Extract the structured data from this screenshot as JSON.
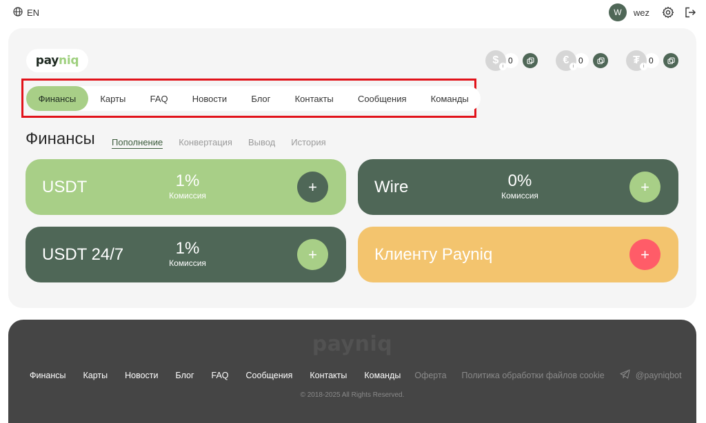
{
  "topbar": {
    "language": "EN",
    "user_initial": "W",
    "username": "wez"
  },
  "logo": {
    "left": "pay",
    "right": "niq"
  },
  "balances": [
    {
      "symbol": "$",
      "value": "0",
      "icon": "dollar-icon"
    },
    {
      "symbol": "€",
      "value": "0",
      "icon": "euro-icon"
    },
    {
      "symbol": "₮",
      "value": "0",
      "icon": "tether-icon"
    }
  ],
  "nav": {
    "items": [
      "Финансы",
      "Карты",
      "FAQ",
      "Новости",
      "Блог",
      "Контакты",
      "Сообщения",
      "Команды"
    ],
    "active": "Финансы"
  },
  "section": {
    "title": "Финансы",
    "subtabs": [
      "Пополнение",
      "Конвертация",
      "Вывод",
      "История"
    ],
    "active_subtab": "Пополнение"
  },
  "cards": [
    {
      "name": "USDT",
      "fee": "1%",
      "fee_label": "Комиссия"
    },
    {
      "name": "Wire",
      "fee": "0%",
      "fee_label": "Комиссия"
    },
    {
      "name": "USDT 24/7",
      "fee": "1%",
      "fee_label": "Комиссия"
    },
    {
      "name": "Клиенту Payniq",
      "fee": "",
      "fee_label": ""
    }
  ],
  "colors": {
    "green_light": "#a8cf87",
    "green_dark": "#4f6757",
    "orange": "#f3c46e",
    "red": "#ff5c68",
    "highlight_frame": "#e1121a"
  },
  "footer": {
    "logo": "payniq",
    "links": [
      "Финансы",
      "Карты",
      "Новости",
      "Блог",
      "FAQ",
      "Сообщения",
      "Контакты",
      "Команды"
    ],
    "muted_links": [
      "Оферта",
      "Политика обработки файлов cookie"
    ],
    "telegram": "@payniqbot",
    "copyright": "© 2018-2025 All Rights Reserved."
  }
}
